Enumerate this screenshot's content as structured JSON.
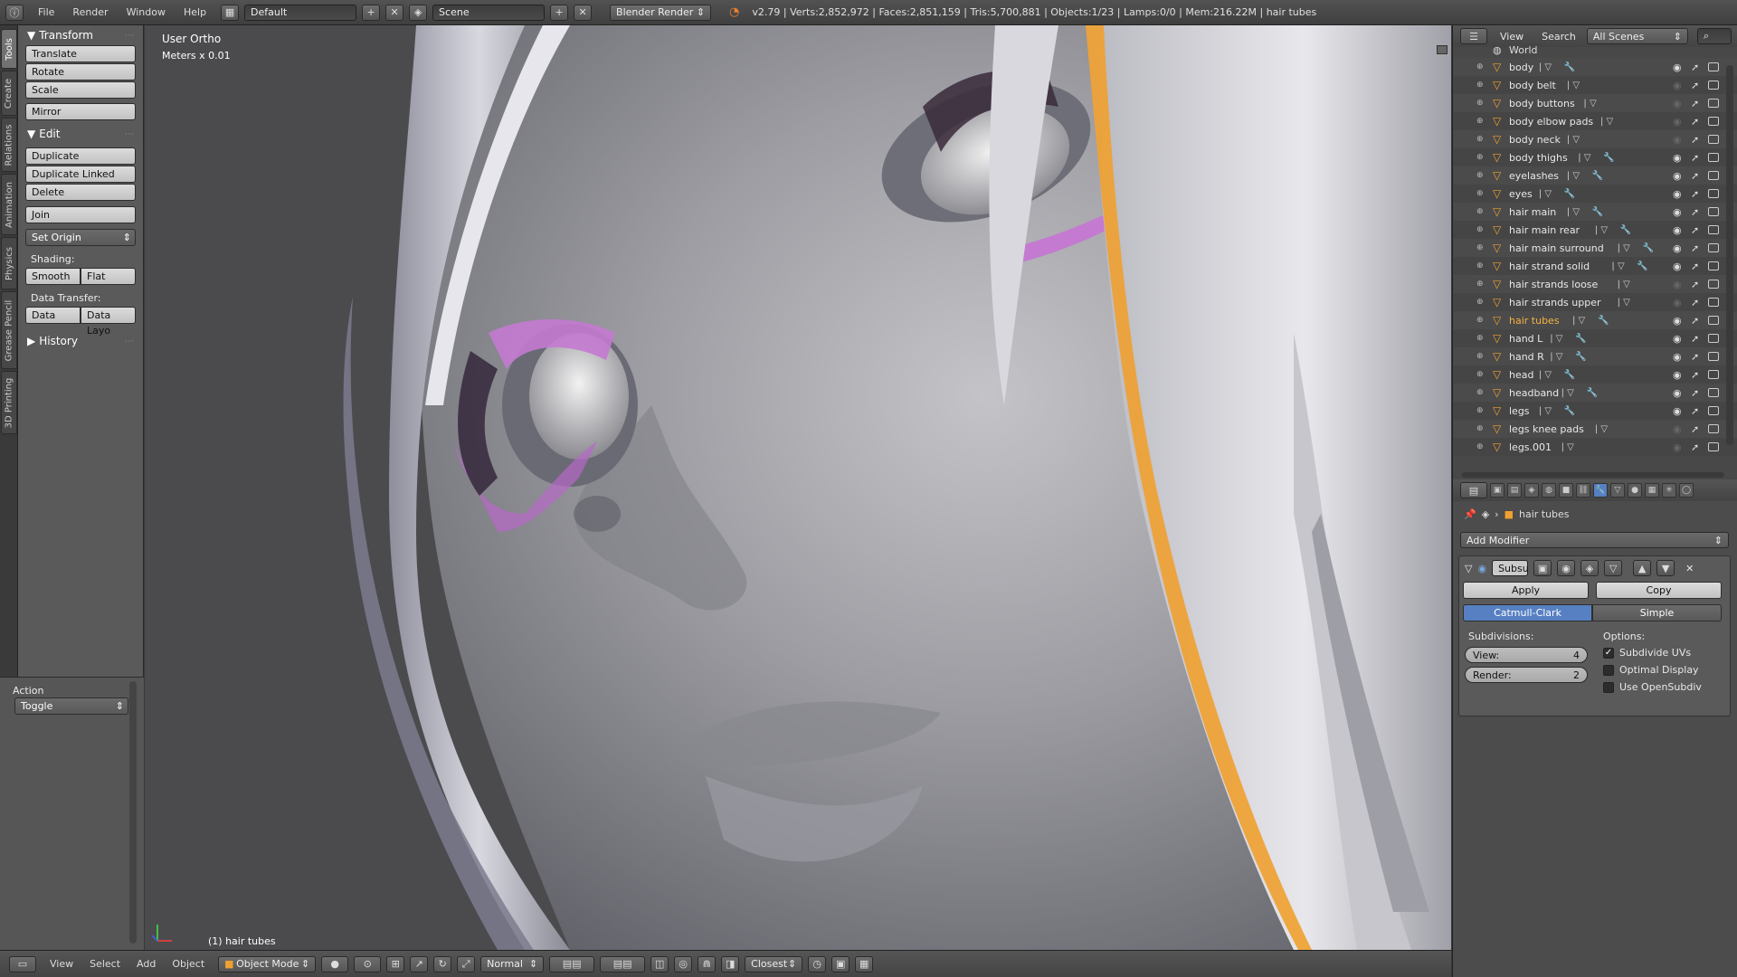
{
  "topbar": {
    "menus": [
      "File",
      "Render",
      "Window",
      "Help"
    ],
    "layout": "Default",
    "scene": "Scene",
    "engine": "Blender Render",
    "stats": "v2.79 | Verts:2,852,972 | Faces:2,851,159 | Tris:5,700,881 | Objects:1/23 | Lamps:0/0 | Mem:216.22M | hair tubes"
  },
  "vtabs": [
    "Tools",
    "Create",
    "Relations",
    "Animation",
    "Physics",
    "Grease Pencil",
    "3D Printing"
  ],
  "toolshelf": {
    "transform": {
      "title": "Transform",
      "buttons": [
        "Translate",
        "Rotate",
        "Scale",
        "Mirror"
      ]
    },
    "edit": {
      "title": "Edit",
      "buttons": [
        "Duplicate",
        "Duplicate Linked",
        "Delete",
        "Join"
      ],
      "set_origin": "Set Origin",
      "shading_label": "Shading:",
      "shading": [
        "Smooth",
        "Flat"
      ],
      "data_transfer_label": "Data Transfer:",
      "data_transfer": [
        "Data",
        "Data Layo"
      ]
    },
    "history": "History"
  },
  "action": {
    "title": "Action",
    "value": "Toggle"
  },
  "viewport": {
    "view_name": "User Ortho",
    "units": "Meters x 0.01",
    "object_label": "(1) hair tubes"
  },
  "bottombar": {
    "menus": [
      "View",
      "Select",
      "Add",
      "Object"
    ],
    "mode": "Object Mode",
    "orientation": "Normal",
    "snap": "Closest"
  },
  "outliner": {
    "menus": [
      "View",
      "Search"
    ],
    "scenes": "All Scenes",
    "world": "World",
    "items": [
      {
        "name": "body",
        "visible": true,
        "wrench": true
      },
      {
        "name": "body belt",
        "visible": false,
        "wrench": false
      },
      {
        "name": "body buttons",
        "visible": false,
        "wrench": false
      },
      {
        "name": "body elbow pads",
        "visible": false,
        "wrench": false
      },
      {
        "name": "body neck",
        "visible": false,
        "wrench": false
      },
      {
        "name": "body thighs",
        "visible": true,
        "wrench": true
      },
      {
        "name": "eyelashes",
        "visible": true,
        "wrench": true
      },
      {
        "name": "eyes",
        "visible": true,
        "wrench": true
      },
      {
        "name": "hair main",
        "visible": true,
        "wrench": true
      },
      {
        "name": "hair main rear",
        "visible": true,
        "wrench": true
      },
      {
        "name": "hair main surround",
        "visible": true,
        "wrench": true
      },
      {
        "name": "hair strand solid",
        "visible": true,
        "wrench": true
      },
      {
        "name": "hair strands loose",
        "visible": false,
        "wrench": false
      },
      {
        "name": "hair strands upper",
        "visible": false,
        "wrench": false
      },
      {
        "name": "hair tubes",
        "visible": true,
        "wrench": true,
        "selected": true
      },
      {
        "name": "hand L",
        "visible": true,
        "wrench": true
      },
      {
        "name": "hand R",
        "visible": true,
        "wrench": true
      },
      {
        "name": "head",
        "visible": true,
        "wrench": true
      },
      {
        "name": "headband",
        "visible": true,
        "wrench": true
      },
      {
        "name": "legs",
        "visible": true,
        "wrench": true
      },
      {
        "name": "legs knee pads",
        "visible": false,
        "wrench": false
      },
      {
        "name": "legs.001",
        "visible": false,
        "wrench": false
      }
    ]
  },
  "properties": {
    "object_name": "hair tubes",
    "add_modifier": "Add Modifier",
    "modifier_name": "Subsu",
    "apply": "Apply",
    "copy": "Copy",
    "algorithms": [
      "Catmull-Clark",
      "Simple"
    ],
    "subdivisions_label": "Subdivisions:",
    "view_label": "View:",
    "view_value": "4",
    "render_label": "Render:",
    "render_value": "2",
    "options_label": "Options:",
    "options": [
      {
        "label": "Subdivide UVs",
        "checked": true
      },
      {
        "label": "Optimal Display",
        "checked": false
      },
      {
        "label": "Use OpenSubdiv",
        "checked": false
      }
    ]
  }
}
